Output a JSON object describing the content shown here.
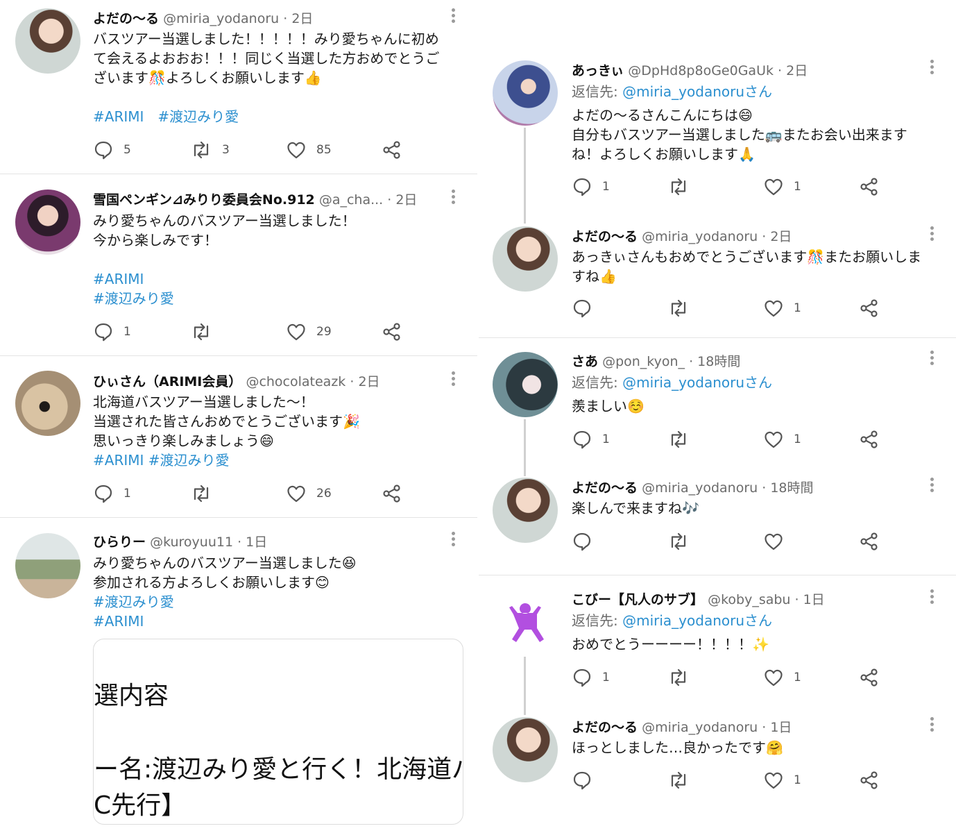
{
  "left_tweets": [
    {
      "name": "よだの〜る",
      "handle": "@miria_yodanoru",
      "time": "· 2日",
      "text": "バスツアー当選しました！！！！！みり愛ちゃんに初め\nて会えるよおおお！！！同じく当選した方おめでとうご\nざいます🎊よろしくお願いします👍",
      "tags": "#ARIMI　#渡辺みり愛",
      "replies": "5",
      "retweets": "3",
      "likes": "85"
    },
    {
      "name": "雪国ペンギン⊿みりり委員会No.912",
      "handle": "@a_cha...",
      "time": "· 2日",
      "text": "みり愛ちゃんのバスツアー当選しました！\n今から楽しみです！",
      "tags": " #ARIMI\n#渡辺みり愛",
      "replies": "1",
      "retweets": "",
      "likes": "29"
    },
    {
      "name": "ひぃさん（ARIMI会員）",
      "handle": "@chocolateazk",
      "time": "· 2日",
      "text": "北海道バスツアー当選しました〜！\n当選された皆さんおめでとうございます🎉\n思いっきり楽しみましょう😄",
      "tags": "#ARIMI #渡辺みり愛",
      "replies": "1",
      "retweets": "",
      "likes": "26"
    },
    {
      "name": "ひらりー",
      "handle": "@kuroyuu11",
      "time": "· 1日",
      "text": "みり愛ちゃんのバスツアー当選しました😆\n参加される方よろしくお願いします😊",
      "tags": " #渡辺みり愛\n #ARIMI",
      "replies": "",
      "retweets": "",
      "likes": ""
    }
  ],
  "card": {
    "line1": "選内容",
    "line2": "ー名:渡辺みり愛と行く！北海道バス",
    "line3": "C先行】"
  },
  "right_tweets": [
    {
      "name": "あっきぃ",
      "handle": "@DpHd8p8oGe0GaUk",
      "time": "· 2日",
      "reply_prefix": "返信先: ",
      "reply_mention": "@miria_yodanoruさん",
      "text": "よだの〜るさんこんにちは😄\n自分もバスツアー当選しました🚌またお会い出来ます\nね！よろしくお願いします🙏",
      "replies": "1",
      "retweets": "",
      "likes": "1"
    },
    {
      "name": "よだの〜る",
      "handle": "@miria_yodanoru",
      "time": "· 2日",
      "text": "あっきぃさんもおめでとうございます🎊またお願いしま\nすね👍",
      "replies": "",
      "retweets": "",
      "likes": "1"
    },
    {
      "name": "さあ",
      "handle": "@pon_kyon_",
      "time": "· 18時間",
      "reply_prefix": "返信先: ",
      "reply_mention": "@miria_yodanoruさん",
      "text": "羨ましい☺️",
      "replies": "1",
      "retweets": "",
      "likes": "1"
    },
    {
      "name": "よだの〜る",
      "handle": "@miria_yodanoru",
      "time": "· 18時間",
      "text": "楽しんで来ますね🎶",
      "replies": "",
      "retweets": "",
      "likes": ""
    },
    {
      "name": "こびー【凡人のサブ】",
      "handle": "@koby_sabu",
      "time": "· 1日",
      "reply_prefix": "返信先: ",
      "reply_mention": "@miria_yodanoruさん",
      "text": "おめでとうーーーー！！！！✨",
      "replies": "1",
      "retweets": "",
      "likes": "1"
    },
    {
      "name": "よだの〜る",
      "handle": "@miria_yodanoru",
      "time": "· 1日",
      "text": "ほっとしました…良かったです🤗",
      "replies": "",
      "retweets": "",
      "likes": "1"
    }
  ],
  "icons": {
    "reply": "reply-icon",
    "retweet": "retweet-icon",
    "like": "heart-icon",
    "share": "share-icon",
    "more": "more-icon"
  },
  "colors": {
    "link": "#2b8fcf",
    "secondary_text": "#6b6b6b",
    "divider": "#e4e4e4",
    "thread_line": "#d0d0d0"
  }
}
